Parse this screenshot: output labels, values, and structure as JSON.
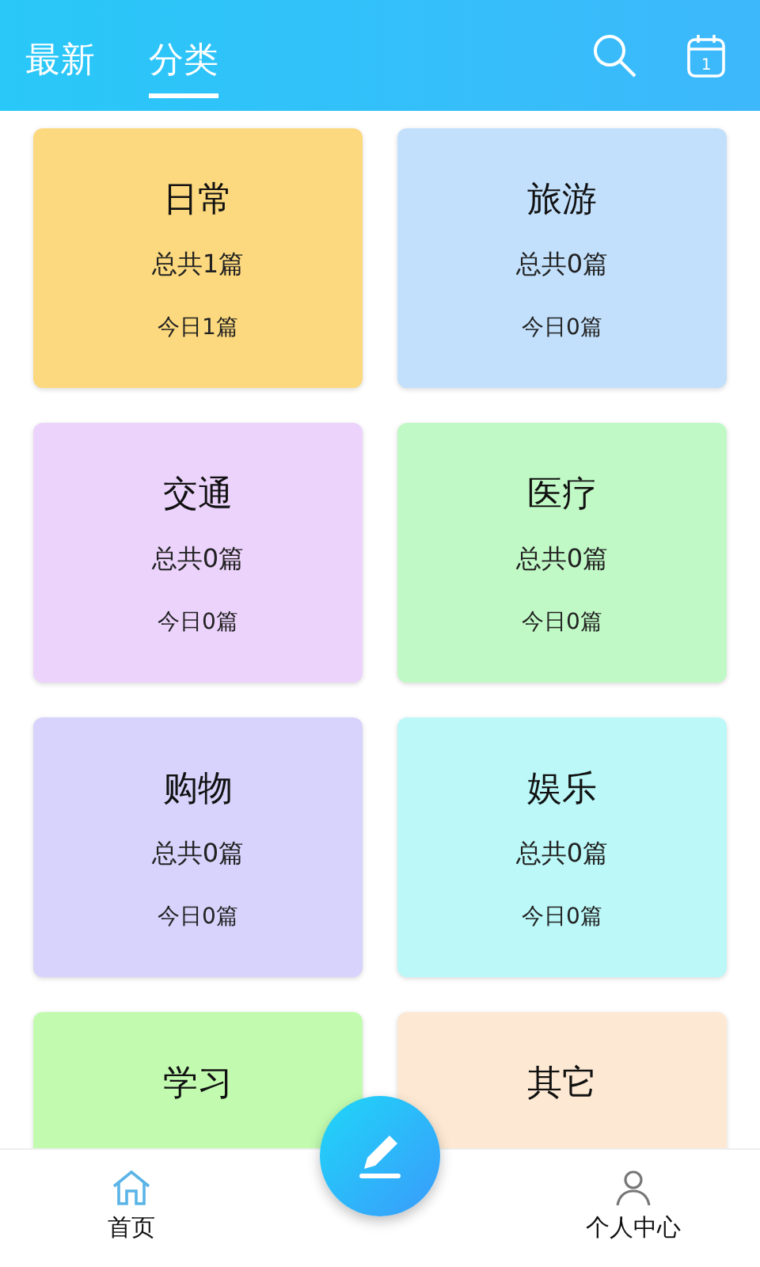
{
  "header": {
    "tabs": [
      {
        "label": "最新",
        "selected": false
      },
      {
        "label": "分类",
        "selected": true
      }
    ]
  },
  "categories": [
    {
      "name": "日常",
      "total": "总共1篇",
      "today": "今日1篇",
      "color": "#fcd97e"
    },
    {
      "name": "旅游",
      "total": "总共0篇",
      "today": "今日0篇",
      "color": "#c2e0fc"
    },
    {
      "name": "交通",
      "total": "总共0篇",
      "today": "今日0篇",
      "color": "#ecd3fc"
    },
    {
      "name": "医疗",
      "total": "总共0篇",
      "today": "今日0篇",
      "color": "#c1f9c6"
    },
    {
      "name": "购物",
      "total": "总共0篇",
      "today": "今日0篇",
      "color": "#d7d3fc"
    },
    {
      "name": "娱乐",
      "total": "总共0篇",
      "today": "今日0篇",
      "color": "#bcf8f8"
    },
    {
      "name": "学习",
      "color": "#c2fbb0"
    },
    {
      "name": "其它",
      "color": "#fde9d3"
    }
  ],
  "calendar_icon": {
    "day": "1"
  },
  "bottom_nav": [
    {
      "label": "首页",
      "kind": "home",
      "selected": true
    },
    {
      "label": "个人中心",
      "kind": "profile",
      "selected": false
    }
  ]
}
